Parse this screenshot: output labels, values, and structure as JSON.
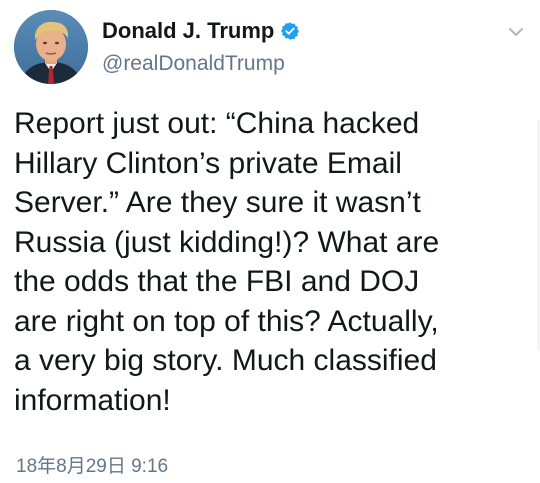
{
  "tweet": {
    "author": {
      "name": "Donald J. Trump",
      "handle": "@realDonaldTrump",
      "verified": true,
      "avatar_icon": "profile-photo-avatar"
    },
    "text": "Report just out: “China hacked\nHillary Clinton’s private Email\nServer.” Are they sure it wasn’t\nRussia (just kidding!)? What are\nthe odds that the FBI and DOJ\nare right on top of this? Actually,\na very big story. Much classified\ninformation!",
    "timestamp": "18年8月29日 9:16",
    "menu_icon": "chevron-down-icon"
  },
  "colors": {
    "text_primary": "#14171a",
    "text_secondary": "#657786",
    "verified_blue": "#1da1f2",
    "background": "#ffffff"
  }
}
